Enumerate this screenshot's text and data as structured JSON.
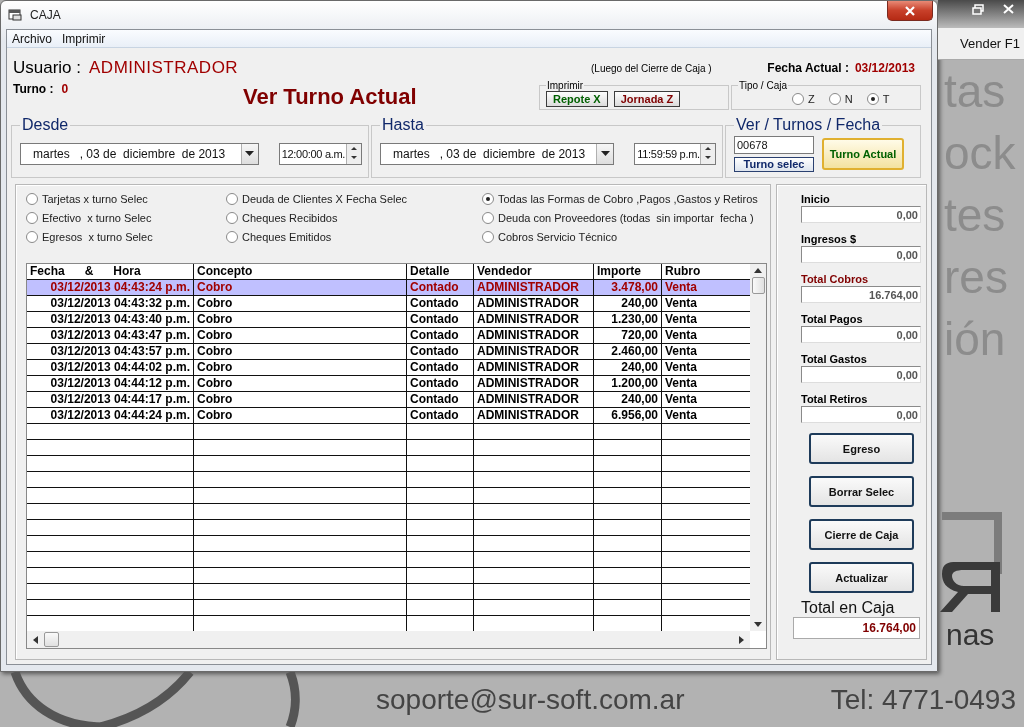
{
  "window": {
    "title": "CAJA"
  },
  "menu": [
    "Archivo",
    "Imprimir"
  ],
  "header": {
    "user_label": "Usuario :",
    "user": "ADMINISTRADOR",
    "turno_label": "Turno :",
    "turno": "0",
    "heading": "Ver Turno Actual",
    "note": "(Luego del Cierre de Caja )",
    "date_label": "Fecha Actual :",
    "date": "03/12/2013"
  },
  "print_group": {
    "title": "Imprimir",
    "buttons": [
      {
        "label": "Repote X",
        "color": "#006000"
      },
      {
        "label": "Jornada Z",
        "color": "#800000"
      }
    ]
  },
  "tipo_caja": {
    "title": "Tipo / Caja",
    "options": [
      {
        "label": "Z",
        "selected": false
      },
      {
        "label": "N",
        "selected": false
      },
      {
        "label": "T",
        "selected": true
      }
    ]
  },
  "desde": {
    "title": "Desde",
    "date": "martes   , 03 de  diciembre  de 2013",
    "time": "12:00:00 a.m."
  },
  "hasta": {
    "title": "Hasta",
    "date": "martes   , 03 de  diciembre  de 2013",
    "time": "11:59:59 p.m."
  },
  "turnos": {
    "title": "Ver / Turnos / Fecha",
    "value": "00678",
    "select_button": "Turno selec",
    "current_button": "Turno Actual"
  },
  "filter_columns": [
    [
      {
        "label": "Tarjetas x turno Selec",
        "selected": false
      },
      {
        "label": "Efectivo  x turno Selec",
        "selected": false
      },
      {
        "label": "Egresos  x turno Selec",
        "selected": false
      }
    ],
    [
      {
        "label": "Deuda de Clientes X Fecha Selec",
        "selected": false
      },
      {
        "label": "Cheques Recibidos",
        "selected": false
      },
      {
        "label": "Cheques Emitidos",
        "selected": false
      }
    ],
    [
      {
        "label": "Todas las Formas de Cobro ,Pagos ,Gastos y Retiros",
        "selected": true
      },
      {
        "label": "Deuda con Proveedores (todas  sin importar  fecha )",
        "selected": false
      },
      {
        "label": "Cobros Servicio Técnico",
        "selected": false
      }
    ]
  ],
  "table": {
    "columns": [
      "Fecha      &      Hora",
      "Concepto",
      "Detalle",
      "Vendedor",
      "Importe",
      "Rubro"
    ],
    "rows": [
      {
        "cells": [
          "03/12/2013 04:43:24 p.m.",
          "Cobro",
          "Contado",
          "ADMINISTRADOR",
          "3.478,00",
          "Venta"
        ],
        "selected": true
      },
      {
        "cells": [
          "03/12/2013 04:43:32 p.m.",
          "Cobro",
          "Contado",
          "ADMINISTRADOR",
          "240,00",
          "Venta"
        ],
        "selected": false
      },
      {
        "cells": [
          "03/12/2013 04:43:40 p.m.",
          "Cobro",
          "Contado",
          "ADMINISTRADOR",
          "1.230,00",
          "Venta"
        ],
        "selected": false
      },
      {
        "cells": [
          "03/12/2013 04:43:47 p.m.",
          "Cobro",
          "Contado",
          "ADMINISTRADOR",
          "720,00",
          "Venta"
        ],
        "selected": false
      },
      {
        "cells": [
          "03/12/2013 04:43:57 p.m.",
          "Cobro",
          "Contado",
          "ADMINISTRADOR",
          "2.460,00",
          "Venta"
        ],
        "selected": false
      },
      {
        "cells": [
          "03/12/2013 04:44:02 p.m.",
          "Cobro",
          "Contado",
          "ADMINISTRADOR",
          "240,00",
          "Venta"
        ],
        "selected": false
      },
      {
        "cells": [
          "03/12/2013 04:44:12 p.m.",
          "Cobro",
          "Contado",
          "ADMINISTRADOR",
          "1.200,00",
          "Venta"
        ],
        "selected": false
      },
      {
        "cells": [
          "03/12/2013 04:44:17 p.m.",
          "Cobro",
          "Contado",
          "ADMINISTRADOR",
          "240,00",
          "Venta"
        ],
        "selected": false
      },
      {
        "cells": [
          "03/12/2013 04:44:24 p.m.",
          "Cobro",
          "Contado",
          "ADMINISTRADOR",
          "6.956,00",
          "Venta"
        ],
        "selected": false
      }
    ]
  },
  "totals": [
    {
      "label": "Inicio",
      "value": "0,00",
      "color": "#000000"
    },
    {
      "label": "Ingresos $",
      "value": "0,00",
      "color": "#000000"
    },
    {
      "label": "Total Cobros",
      "value": "16.764,00",
      "color": "#800000"
    },
    {
      "label": "Total Pagos",
      "value": "0,00",
      "color": "#000000"
    },
    {
      "label": "Total Gastos",
      "value": "0,00",
      "color": "#000000"
    },
    {
      "label": "Total Retiros",
      "value": "0,00",
      "color": "#000000"
    }
  ],
  "actions": [
    "Egreso",
    "Borrar Selec",
    "Cierre de Caja",
    "Actualizar"
  ],
  "total_en_caja": {
    "label": "Total en Caja",
    "value": "16.764,00"
  },
  "background": {
    "menu_item": "Vender F1",
    "fragments": [
      "tas",
      "ock",
      "tes",
      "res",
      "ión"
    ],
    "logo_text": "nas",
    "email": "soporte@sur-soft.com.ar",
    "phone": "Tel: 4771-0493"
  }
}
